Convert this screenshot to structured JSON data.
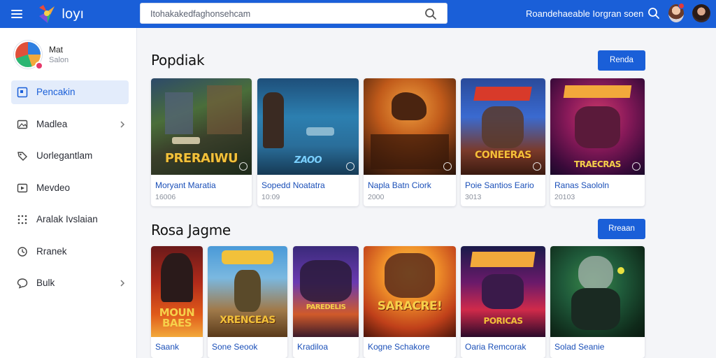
{
  "header": {
    "brand": "loyı",
    "search_value": "Itohakakedfaghonsehcam",
    "link": "Roandehaeable Iorgran soen"
  },
  "profile": {
    "name": "Mat",
    "subtitle": "Salon"
  },
  "sidebar": {
    "items": [
      {
        "label": "Pencakin",
        "icon": "grid-icon"
      },
      {
        "label": "Madlea",
        "icon": "image-icon"
      },
      {
        "label": "Uorlegantlam",
        "icon": "tag-icon"
      },
      {
        "label": "Mevdeo",
        "icon": "video-icon"
      },
      {
        "label": "Aralak Ivslaian",
        "icon": "dots-grid-icon"
      },
      {
        "label": "Rranek",
        "icon": "clock-icon"
      },
      {
        "label": "Bulk",
        "icon": "comment-icon"
      }
    ]
  },
  "sections": [
    {
      "title": "Popdiak",
      "button": "Renda",
      "cards": [
        {
          "title": "Moryant Maratia",
          "meta": "16006",
          "poster": "PRERAIWU"
        },
        {
          "title": "Sopedd Noatatra",
          "meta": "10:09",
          "poster": "ZAOO"
        },
        {
          "title": "Napla Batn Ciork",
          "meta": "2000",
          "poster": ""
        },
        {
          "title": "Poie Santios Eario",
          "meta": "3013",
          "poster": "CONEERAS"
        },
        {
          "title": "Ranas Saololn",
          "meta": "20103",
          "poster": "TRAECRAS"
        }
      ]
    },
    {
      "title": "Rosa Jagme",
      "button": "Rreaan",
      "cards": [
        {
          "title": "Saank",
          "poster": "MOUN BAES"
        },
        {
          "title": "Sone Seook",
          "poster": "XRENCEAS"
        },
        {
          "title": "Kradiloa",
          "poster": "PAREDELIS"
        },
        {
          "title": "Kogne Schakore",
          "poster": "SARACRE!"
        },
        {
          "title": "Oaria Remcorak",
          "poster": "PORICAS"
        },
        {
          "title": "Solad Seanie",
          "poster": ""
        }
      ]
    }
  ],
  "colors": {
    "accent": "#1a5fd8",
    "link": "#1a4fb8"
  }
}
